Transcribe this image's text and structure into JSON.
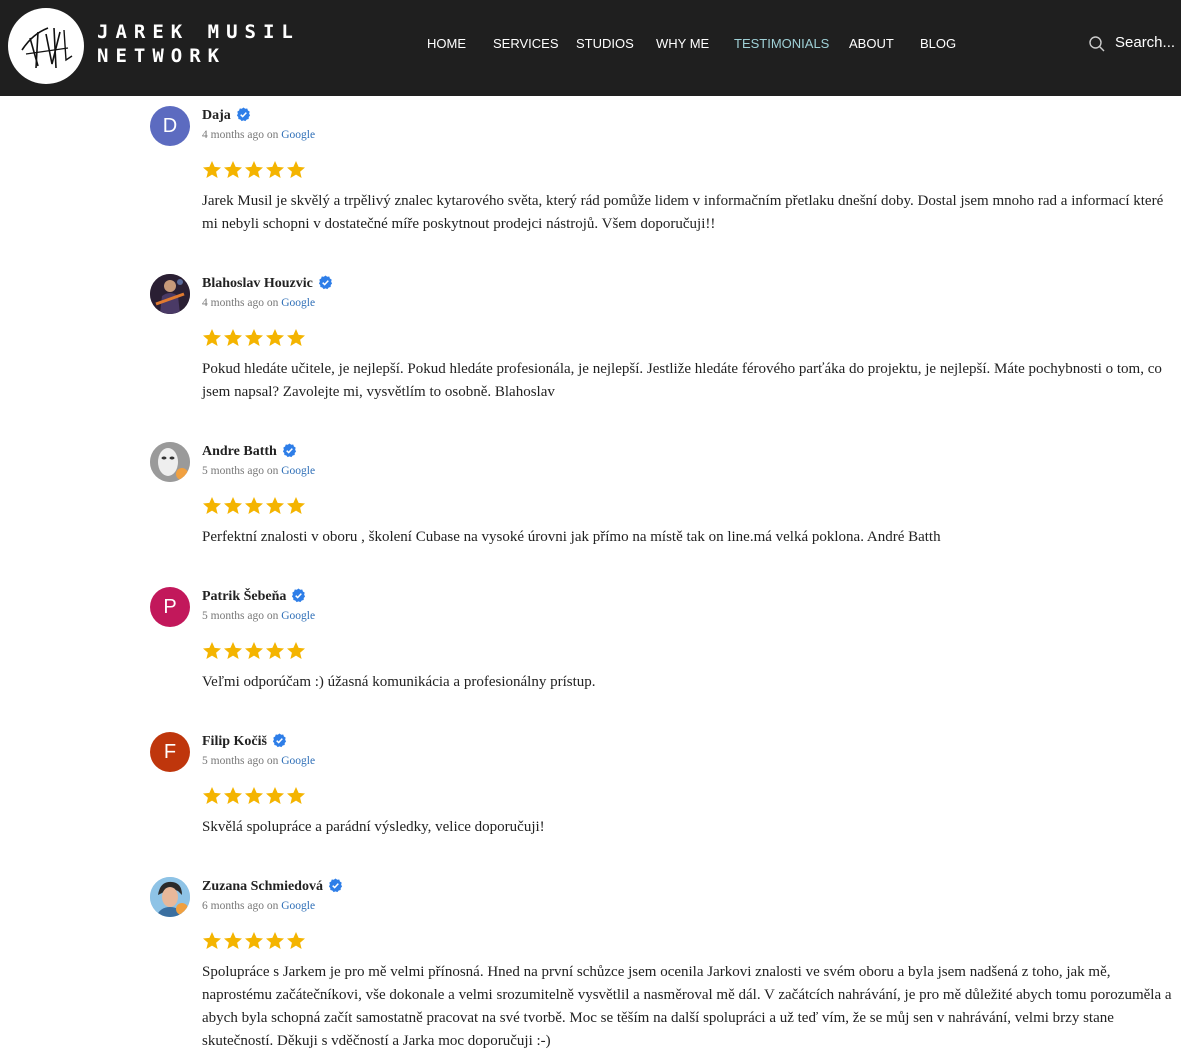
{
  "header": {
    "brand_line1": "JAREK MUSIL",
    "brand_line2": "NETWORK",
    "nav": [
      {
        "label": "HOME",
        "active": false
      },
      {
        "label": "SERVICES",
        "active": false
      },
      {
        "label": "STUDIOS",
        "active": false
      },
      {
        "label": "WHY ME",
        "active": false
      },
      {
        "label": "TESTIMONIALS",
        "active": true
      },
      {
        "label": "ABOUT",
        "active": false
      },
      {
        "label": "BLOG",
        "active": false
      }
    ],
    "search_label": "Search..."
  },
  "colors": {
    "header_bg": "#1f1f1f",
    "nav_active": "#9fd0d6",
    "star": "#f4b400",
    "verified": "#2e7ee8",
    "google_link": "#2f6fb7"
  },
  "reviews": [
    {
      "name": "Daja",
      "initial": "D",
      "avatar_color": "#5c6bc0",
      "time": "4 months ago",
      "on": "on",
      "source": "Google",
      "rating": 5,
      "text": "Jarek Musil je skvělý a trpělivý znalec kytarového světa, který rád pomůže lidem v informačním přetlaku dnešní doby. Dostal jsem mnoho rad a informací které mi nebyli schopni v dostatečné míře poskytnout prodejci nástrojů. Všem doporučuji!!"
    },
    {
      "name": "Blahoslav Houzvic",
      "initial": "",
      "avatar_color": "#3a2a3a",
      "time": "4 months ago",
      "on": "on",
      "source": "Google",
      "rating": 5,
      "text": "Pokud hledáte učitele, je nejlepší. Pokud hledáte profesionála, je nejlepší. Jestliže hledáte férového parťáka do projektu, je nejlepší. Máte pochybnosti o tom, co jsem napsal? Zavolejte mi, vysvětlím to osobně. Blahoslav"
    },
    {
      "name": "Andre Batth",
      "initial": "",
      "avatar_color": "#b8b8b8",
      "time": "5 months ago",
      "on": "on",
      "source": "Google",
      "rating": 5,
      "text": "Perfektní znalosti v oboru , školení Cubase na vysoké úrovni jak přímo na místě tak on line.má velká poklona. André Batth"
    },
    {
      "name": "Patrik Šebeňa",
      "initial": "P",
      "avatar_color": "#c2185b",
      "time": "5 months ago",
      "on": "on",
      "source": "Google",
      "rating": 5,
      "text": "Veľmi odporúčam :) úžasná komunikácia a profesionálny prístup."
    },
    {
      "name": "Filip Kočiš",
      "initial": "F",
      "avatar_color": "#bf360c",
      "time": "5 months ago",
      "on": "on",
      "source": "Google",
      "rating": 5,
      "text": "Skvělá spolupráce a parádní výsledky, velice doporučuji!"
    },
    {
      "name": "Zuzana Schmiedová",
      "initial": "",
      "avatar_color": "#7fb3d8",
      "time": "6 months ago",
      "on": "on",
      "source": "Google",
      "rating": 5,
      "text": "Spolupráce s Jarkem je pro mě velmi přínosná. Hned na první schůzce jsem ocenila Jarkovi znalosti ve svém oboru a byla jsem nadšená z toho, jak mě, naprostému začátečníkovi, vše dokonale a velmi srozumitelně vysvětlil a nasměroval mě dál. V začátcích nahrávání, je pro mě důležité abych tomu porozuměla a abych byla schopná začít samostatně pracovat na své tvorbě. Moc se těším na další spolupráci a už teď vím, že se můj sen v nahrávání, velmi brzy stane skutečností. Děkuji s vděčností a Jarka moc doporučuji :-)"
    }
  ]
}
